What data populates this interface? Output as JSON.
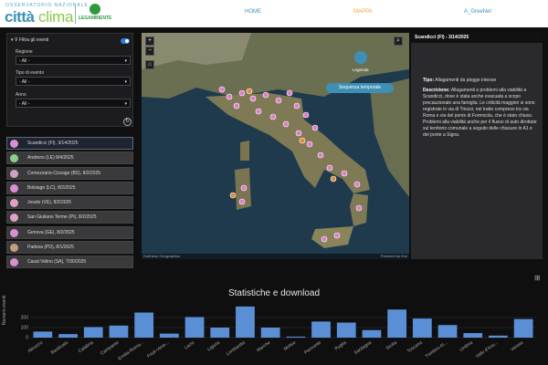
{
  "header": {
    "brand_top": "OSSERVATORIO NAZIONALE",
    "brand_citta": "città",
    "brand_clima": "clima",
    "partner": "LEGAMBIENTE",
    "nav": {
      "home": "HOME",
      "mappa": "MAPPA",
      "user": "A_GreeNet"
    },
    "colors": {
      "blue": "#3f8fb5",
      "green": "#8cc84b",
      "orange": "#f5a23b"
    }
  },
  "filters": {
    "title": "Filtra gli eventi",
    "regione_label": "Regione",
    "regione_value": "- All -",
    "tipo_label": "Tipo di evento",
    "tipo_value": "- All -",
    "anno_label": "Anno",
    "anno_value": "- All -"
  },
  "events": [
    {
      "label": "Scandicci  (FI), 3/14/2025",
      "color": "#d98fd0"
    },
    {
      "label": "Andreno  (LE) 8/4/2025",
      "color": "#8ccf8f"
    },
    {
      "label": "Comezzano-Cizzago  (BS), 8/2/2025",
      "color": "#c9a5c0"
    },
    {
      "label": "Bolsiago  (LC), 8/2/2025",
      "color": "#d98fd0"
    },
    {
      "label": "Jesolo  (VE), 8/2/2025",
      "color": "#e0a0c8"
    },
    {
      "label": "San Giuliano Terme  (PI), 8/2/2025",
      "color": "#e0a0c8"
    },
    {
      "label": "Genova  (GE), 8/2/2025",
      "color": "#d98fd0"
    },
    {
      "label": "Padova  (PD), 8/1/2025",
      "color": "#c0a080"
    },
    {
      "label": "Casal Velino  (SA), 7/30/2025",
      "color": "#d98fd0"
    }
  ],
  "map": {
    "legend_label": "Legenda",
    "sequence_label": "Sequenza temporale",
    "attrib_left": "Earthstar Geographics",
    "attrib_right": "Powered by Esri"
  },
  "detail": {
    "header": "Scandicci (FI) - 3/14/2025",
    "tipo_label": "Tipo:",
    "tipo_value": "Allagamenti da piogge intense",
    "desc_label": "Descrizione:",
    "desc_value": "Allagamenti e problemi alla viabilità a Scandicci, dove è stata anche evacuata a scopo precauzionale una famiglia. Le criticità maggiori si sono registrate in via di Triozzi, nel tratto compreso tra via Roma e via del ponte di Formicola, che è stato chiuso. Problemi alla viabilità anche per il flusso di auto dirottate sul territorio comunale a seguito delle chiusure in A1 e del ponte a Signa."
  },
  "stats": {
    "title": "Statistiche e download",
    "ylabel": "Numero eventi"
  },
  "chart_data": {
    "type": "bar",
    "title": "",
    "ylabel": "Numero eventi",
    "ylim": [
      0,
      300
    ],
    "yticks": [
      0,
      100,
      200
    ],
    "categories": [
      "Abruzzo",
      "Basilicata",
      "Calabria",
      "Campania",
      "Emilia-Roma...",
      "Friuli-Vene...",
      "Lazio",
      "Liguria",
      "Lombardia",
      "Marche",
      "Molise",
      "Piemonte",
      "Puglia",
      "Sardegna",
      "Sicilia",
      "Toscana",
      "Trentino-Al...",
      "Umbria",
      "Valle d'Aos...",
      "Veneto"
    ],
    "values": [
      60,
      35,
      105,
      120,
      250,
      40,
      205,
      100,
      310,
      100,
      10,
      160,
      150,
      75,
      280,
      190,
      125,
      45,
      20,
      185
    ],
    "bar_color": "#5a8fd6"
  }
}
